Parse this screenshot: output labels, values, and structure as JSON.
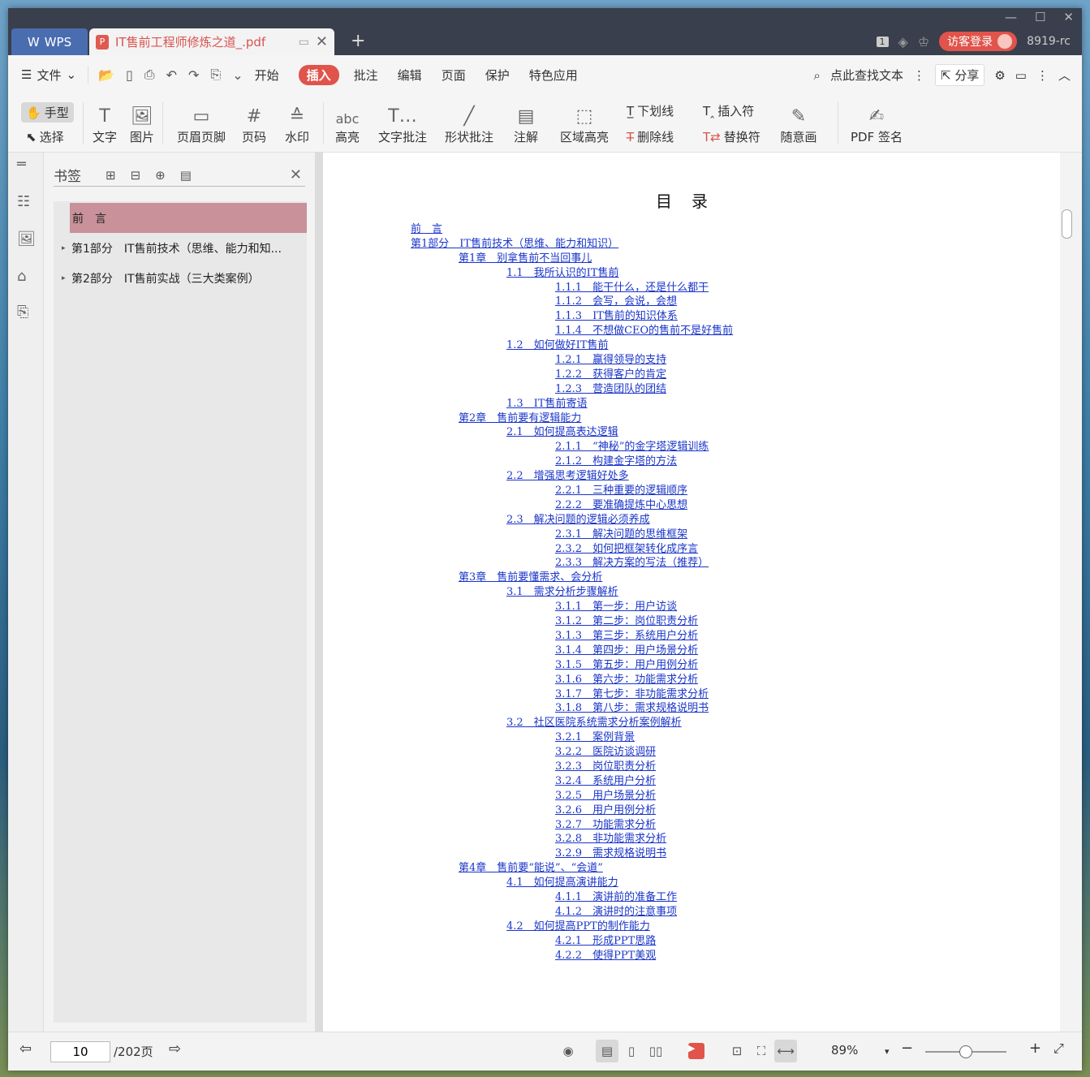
{
  "tabs": {
    "wps_label": "WPS",
    "doc_title": "IT售前工程师修炼之道_.pdf",
    "add": "+"
  },
  "title_right": {
    "badge": "1",
    "login": "访客登录",
    "user": "8919-rc"
  },
  "menu": {
    "file": "文件",
    "items": [
      "开始",
      "插入",
      "批注",
      "编辑",
      "页面",
      "保护",
      "特色应用"
    ],
    "active_index": 1,
    "search_text": "点此查找文本",
    "share": "分享"
  },
  "ribbon": {
    "hand": "手型",
    "select": "选择",
    "text": "文字",
    "image": "图片",
    "header_footer": "页眉页脚",
    "page_number": "页码",
    "watermark": "水印",
    "highlight": "高亮",
    "text_comment": "文字批注",
    "shape_comment": "形状批注",
    "annotation": "注解",
    "area_highlight": "区域高亮",
    "underline": "下划线",
    "strikethrough": "删除线",
    "insert_mark": "插入符",
    "replace_mark": "替换符",
    "freehand": "随意画",
    "pdf_sign": "PDF 签名",
    "highlight_icon_text": "abc",
    "page_icon_text": "#"
  },
  "bookmarks": {
    "title": "书签",
    "items": [
      {
        "label": "前　言",
        "selected": true,
        "expandable": false
      },
      {
        "label": "第1部分　IT售前技术（思维、能力和知...",
        "selected": false,
        "expandable": true
      },
      {
        "label": "第2部分　IT售前实战（三大类案例）",
        "selected": false,
        "expandable": true
      }
    ]
  },
  "document": {
    "toc_title": "目录",
    "toc": [
      {
        "level": 0,
        "text": "前　言"
      },
      {
        "level": 0,
        "text": "第1部分　IT售前技术（思维、能力和知识）"
      },
      {
        "level": 1,
        "text": "第1章　别拿售前不当回事儿"
      },
      {
        "level": 2,
        "text": "1.1　我所认识的IT售前"
      },
      {
        "level": 3,
        "text": "1.1.1　能干什么，还是什么都干"
      },
      {
        "level": 3,
        "text": "1.1.2　会写，会说，会想"
      },
      {
        "level": 3,
        "text": "1.1.3　IT售前的知识体系"
      },
      {
        "level": 3,
        "text": "1.1.4　不想做CEO的售前不是好售前"
      },
      {
        "level": 2,
        "text": "1.2　如何做好IT售前"
      },
      {
        "level": 3,
        "text": "1.2.1　赢得领导的支持"
      },
      {
        "level": 3,
        "text": "1.2.2　获得客户的肯定"
      },
      {
        "level": 3,
        "text": "1.2.3　营造团队的团结"
      },
      {
        "level": 2,
        "text": "1.3　IT售前寄语"
      },
      {
        "level": 1,
        "text": "第2章　售前要有逻辑能力"
      },
      {
        "level": 2,
        "text": "2.1　如何提高表达逻辑"
      },
      {
        "level": 3,
        "text": "2.1.1　“神秘”的金字塔逻辑训练"
      },
      {
        "level": 3,
        "text": "2.1.2　构建金字塔的方法"
      },
      {
        "level": 2,
        "text": "2.2　增强思考逻辑好处多"
      },
      {
        "level": 3,
        "text": "2.2.1　三种重要的逻辑顺序"
      },
      {
        "level": 3,
        "text": "2.2.2　要准确提炼中心思想"
      },
      {
        "level": 2,
        "text": "2.3　解决问题的逻辑必须养成"
      },
      {
        "level": 3,
        "text": "2.3.1　解决问题的思维框架"
      },
      {
        "level": 3,
        "text": "2.3.2　如何把框架转化成序言"
      },
      {
        "level": 3,
        "text": "2.3.3　解决方案的写法（推荐）"
      },
      {
        "level": 1,
        "text": "第3章　售前要懂需求、会分析"
      },
      {
        "level": 2,
        "text": "3.1　需求分析步骤解析"
      },
      {
        "level": 3,
        "text": "3.1.1　第一步：用户访谈"
      },
      {
        "level": 3,
        "text": "3.1.2　第二步：岗位职责分析"
      },
      {
        "level": 3,
        "text": "3.1.3　第三步：系统用户分析"
      },
      {
        "level": 3,
        "text": "3.1.4　第四步：用户场景分析"
      },
      {
        "level": 3,
        "text": "3.1.5　第五步：用户用例分析"
      },
      {
        "level": 3,
        "text": "3.1.6　第六步：功能需求分析"
      },
      {
        "level": 3,
        "text": "3.1.7　第七步：非功能需求分析"
      },
      {
        "level": 3,
        "text": "3.1.8　第八步：需求规格说明书"
      },
      {
        "level": 2,
        "text": "3.2　社区医院系统需求分析案例解析"
      },
      {
        "level": 3,
        "text": "3.2.1　案例背景"
      },
      {
        "level": 3,
        "text": "3.2.2　医院访谈调研"
      },
      {
        "level": 3,
        "text": "3.2.3　岗位职责分析"
      },
      {
        "level": 3,
        "text": "3.2.4　系统用户分析"
      },
      {
        "level": 3,
        "text": "3.2.5　用户场景分析"
      },
      {
        "level": 3,
        "text": "3.2.6　用户用例分析"
      },
      {
        "level": 3,
        "text": "3.2.7　功能需求分析"
      },
      {
        "level": 3,
        "text": "3.2.8　非功能需求分析"
      },
      {
        "level": 3,
        "text": "3.2.9　需求规格说明书"
      },
      {
        "level": 1,
        "text": "第4章　售前要“能说”、“会道”"
      },
      {
        "level": 2,
        "text": "4.1　如何提高演讲能力"
      },
      {
        "level": 3,
        "text": "4.1.1　演讲前的准备工作"
      },
      {
        "level": 3,
        "text": "4.1.2　演讲时的注意事项"
      },
      {
        "level": 2,
        "text": "4.2　如何提高PPT的制作能力"
      },
      {
        "level": 3,
        "text": "4.2.1　形成PPT思路"
      },
      {
        "level": 3,
        "text": "4.2.2　使得PPT美观"
      }
    ]
  },
  "status": {
    "current_page": "10",
    "total_pages": "/202页",
    "zoom": "89%"
  },
  "colors": {
    "accent": "#e0544b",
    "link": "#1a35c9",
    "bookmark_selected": "#c9919a"
  }
}
